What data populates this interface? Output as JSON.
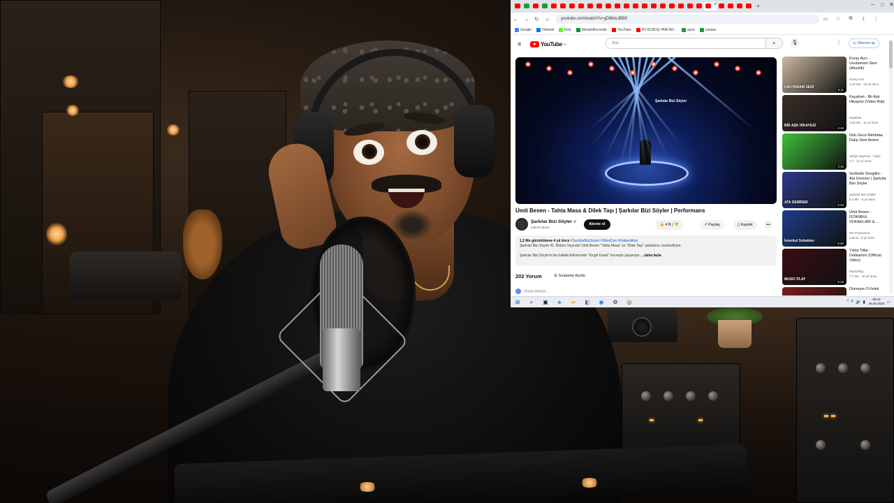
{
  "browser": {
    "tab_count_visible": 26,
    "url": "youtube.com/watch?v=gDBkIvJBB0",
    "new_tab_symbol": "+",
    "window_controls": [
      "–",
      "□",
      "✕"
    ],
    "bookmarks": [
      {
        "label": "Google",
        "icon": "google-icon",
        "color": "#4285f4"
      },
      {
        "label": "Hotmail",
        "icon": "hotmail-icon",
        "color": "#0078d4"
      },
      {
        "label": "Kick",
        "icon": "kick-icon",
        "color": "#53fc18"
      },
      {
        "label": "StreamRecorder",
        "icon": "stream-icon",
        "color": "#0a8f3c"
      },
      {
        "label": "YouTube",
        "icon": "youtube-icon",
        "color": "#ff0000"
      },
      {
        "label": "İKİ OLMUŞ YANİ AD...",
        "icon": "youtube-icon",
        "color": "#ff0000"
      },
      {
        "label": "ayna",
        "icon": "sheet-icon",
        "color": "#1d9b3a"
      },
      {
        "label": "canaxx",
        "icon": "sheet-icon",
        "color": "#1d9b3a"
      }
    ]
  },
  "youtube": {
    "logo_text": "YouTube",
    "logo_region": "TR",
    "search_placeholder": "Ara",
    "sign_in": "Oturum aç",
    "video_title": "Ümit Besen - Tahta Masa & Dilek Taşı | Şarkılar Bizi Söyler | Performans",
    "channel_name": "Şarkılar Bizi Söyler",
    "channel_subs": "6,85 B abone",
    "subscribe_label": "Abone ol",
    "stage_logo": "Şarkılar Bizi Söyler",
    "actions": {
      "likes": "4 B",
      "share": "Paylaş",
      "save": "Kaydet",
      "more": "•••"
    },
    "description": {
      "meta": "1,2 Mn görüntüleme  4 yıl önce",
      "tags": "#SarkilarBiziSoyler #SibelCan #HakanAltun",
      "line1": "Şarkılar Bizi Söyler 41. Bölüm Yayında! Ümit Besen \"Tahta Masa\" ve \"Dilek Taşı\" şarkılarını seslendiriyor.",
      "line2": "Şarkılar Bizi Söyler'in bu haftaki bölümünde \"Kırgık Kaset\" konseptı yaşanıyor.",
      "more": "...daha fazla"
    },
    "comments_count": "202 Yorum",
    "sort_label": "Sıralama ölçütü",
    "add_comment_placeholder": "Yorum ekleyin...",
    "recommendations": [
      {
        "title": "Koray Avcı - Unutamam Seni (Akustik)",
        "channel": "Koray Avcı",
        "meta": "1,42 Mn · 10 yıl önce",
        "duration": "5:11",
        "thumb_label": "UNUTAMAM SENİ",
        "bg": "#cdb9a0"
      },
      {
        "title": "Kayahan - Bir Aşk Hikayesi (Video Klip)",
        "channel": "Kayahan",
        "meta": "1,53 Mn · 11 yıl önce",
        "duration": "4:10",
        "thumb_label": "BİR AŞK HİKAYESİ",
        "bg": "#3a2e28"
      },
      {
        "title": "Dün Gece Mehtaba Dalıp Seni Andım",
        "channel": "Safiye Soyman - Topic",
        "meta": "2,7 · 11 yıl önce",
        "duration": "3:15",
        "thumb_label": "",
        "bg": "#3fbf3a"
      },
      {
        "title": "Gurbette Sevgilim - Ata Demirer | Şarkılar Bizi Söyler",
        "channel": "Şarkılar Bizi Söyler",
        "meta": "9,4 Mn · 5 yıl önce",
        "duration": "5:33",
        "thumb_label": "ATA DEMİRER",
        "bg": "#2b3a8a"
      },
      {
        "title": "Ümit Besen - İSTANBUL SOKAKLARI & ...",
        "channel": "Pai Production",
        "meta": "2,56 B · 8 yıl önce",
        "duration": "5:20",
        "thumb_label": "İstanbul Sokakları",
        "bg": "#1e3d8a"
      },
      {
        "title": "Yıldız Tilbe - Delikanlım (Official Video)",
        "channel": "MusicPlay",
        "meta": "7,7 Mn · 10 yıl önce",
        "duration": "5:12",
        "thumb_label": "MUSIC PLAY",
        "bg": "#3a0d14"
      },
      {
        "title": "Dümeyin O Felek",
        "channel": "",
        "meta": "",
        "duration": "",
        "thumb_label": "",
        "bg": "#7a1d1d"
      }
    ]
  },
  "taskbar": {
    "icons": [
      "windows-start-icon",
      "search-icon",
      "task-view-icon",
      "copilot-icon",
      "file-explorer-icon",
      "teams-icon",
      "chrome-icon",
      "settings-icon",
      "obs-icon"
    ],
    "time": "09:42",
    "date": "26.08.2025"
  },
  "colors": {
    "youtube_red": "#ff0000",
    "link_blue": "#065fd4",
    "subscribe_bg": "#0f0f0f"
  }
}
